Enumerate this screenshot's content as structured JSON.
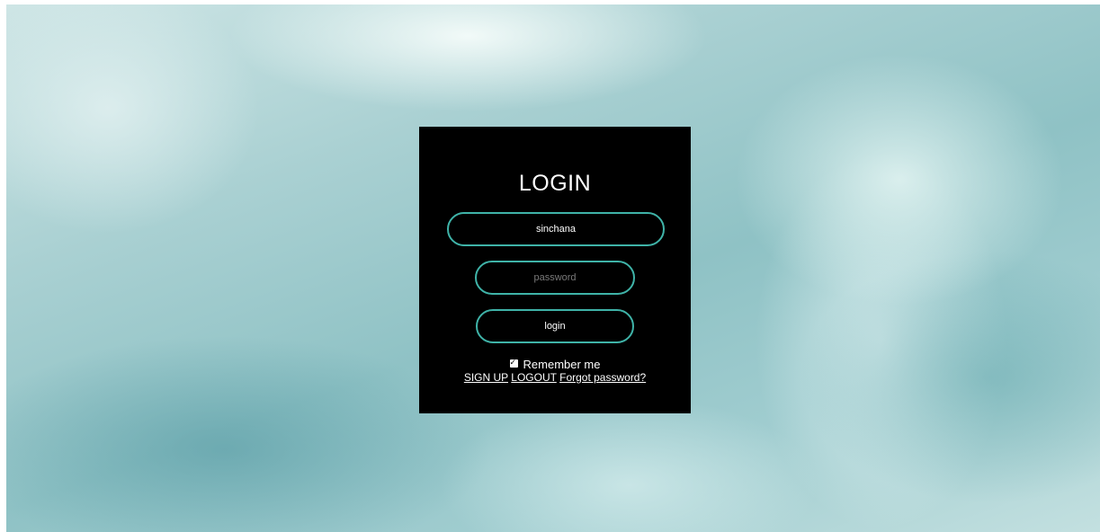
{
  "login": {
    "title": "LOGIN",
    "username_value": "sinchana",
    "password_placeholder": "password",
    "button_label": "login",
    "remember_label": "Remember me",
    "remember_checked": true,
    "links": {
      "signup": "SIGN UP",
      "logout": "LOGOUT",
      "forgot": "Forgot password?"
    }
  },
  "colors": {
    "card_background": "#000000",
    "accent_border": "#3fb3a8",
    "text": "#ffffff"
  }
}
